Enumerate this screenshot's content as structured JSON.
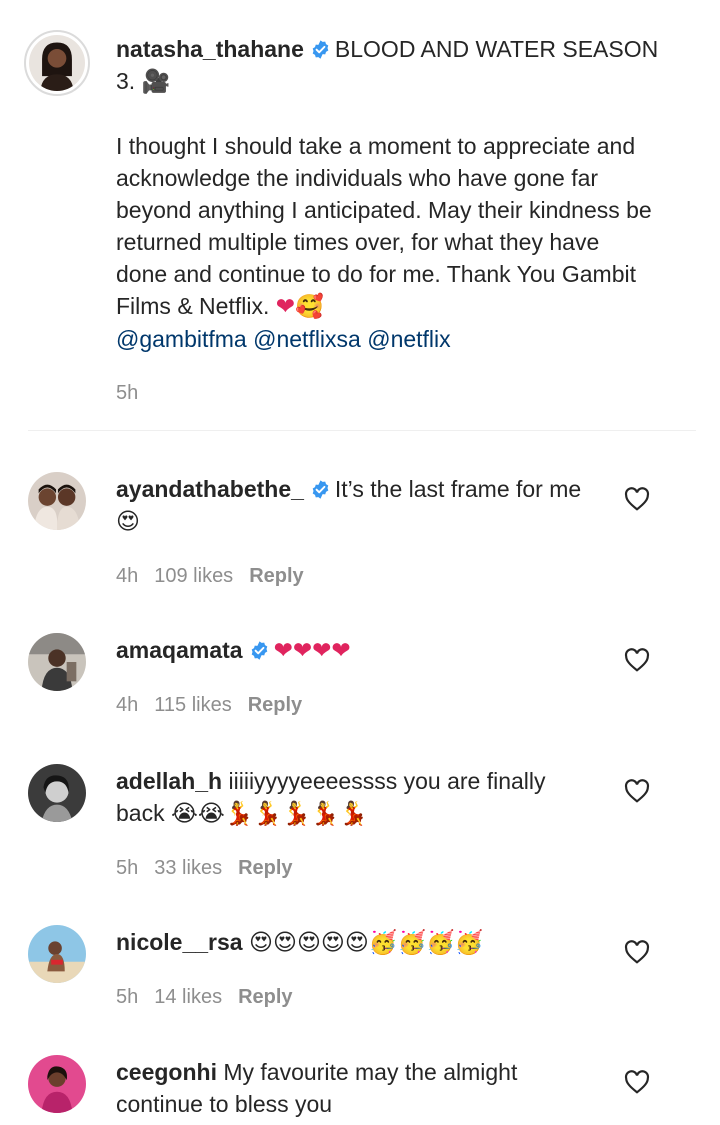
{
  "caption": {
    "username": "natasha_thahane",
    "title": "BLOOD AND WATER SEASON 3.",
    "title_emoji": "🎥",
    "body": "I thought I should take a moment to appreciate and acknowledge the individuals who have gone far beyond anything I anticipated. May their kindness be returned multiple times over, for what they have done and continue to do for me. Thank You Gambit Films & Netflix.",
    "body_emoji": "❤🥰",
    "mentions": "@gambitfma @netflixsa @netflix",
    "time": "5h"
  },
  "comments": [
    {
      "username": "ayandathabethe_",
      "verified": true,
      "text": "It’s the last frame for me",
      "emoji": "😍",
      "time": "4h",
      "likes": "109 likes",
      "reply": "Reply"
    },
    {
      "username": "amaqamata",
      "verified": true,
      "text": "",
      "emoji": "❤❤❤❤",
      "time": "4h",
      "likes": "115 likes",
      "reply": "Reply"
    },
    {
      "username": "adellah_h",
      "verified": false,
      "text": "iiiiiyyyyeeeessss you are finally back",
      "emoji": "😭😭💃💃💃💃💃",
      "time": "5h",
      "likes": "33 likes",
      "reply": "Reply"
    },
    {
      "username": "nicole__rsa",
      "verified": false,
      "text": "",
      "emoji": "😍😍😍😍😍🥳🥳🥳🥳",
      "time": "5h",
      "likes": "14 likes",
      "reply": "Reply"
    },
    {
      "username": "ceegonhi",
      "verified": false,
      "text": "My favourite may the almight continue to bless you",
      "emoji": "",
      "time": "",
      "likes": "",
      "reply": ""
    }
  ],
  "icons": {
    "verified": "verified-badge-icon",
    "like": "heart-outline-icon"
  },
  "colors": {
    "verified": "#3897f0",
    "mention": "#00376b",
    "meta": "#8e8e8e"
  }
}
